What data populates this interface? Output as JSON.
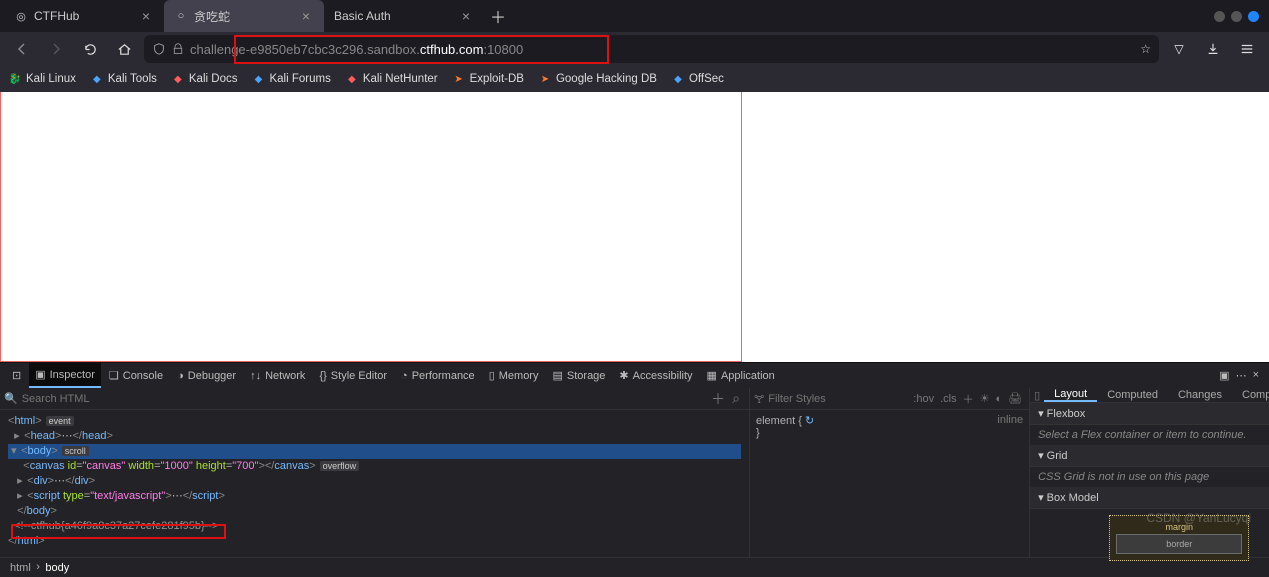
{
  "tabs": [
    {
      "label": "CTFHub",
      "active": false
    },
    {
      "label": "贪吃蛇",
      "active": true
    },
    {
      "label": "Basic Auth",
      "active": false
    }
  ],
  "url": {
    "prefix": "challenge-e9850eb7cbc3c296.sandbox.",
    "host": "ctfhub.com",
    "port": ":10800"
  },
  "bookmarks": [
    {
      "label": "Kali Linux",
      "icon": "🐉",
      "color": "#ccc"
    },
    {
      "label": "Kali Tools",
      "icon": "◆",
      "color": "#4aa3ff"
    },
    {
      "label": "Kali Docs",
      "icon": "◆",
      "color": "#ff5c5c"
    },
    {
      "label": "Kali Forums",
      "icon": "◆",
      "color": "#4aa3ff"
    },
    {
      "label": "Kali NetHunter",
      "icon": "◆",
      "color": "#ff5c5c"
    },
    {
      "label": "Exploit-DB",
      "icon": "➤",
      "color": "#ff7a2a"
    },
    {
      "label": "Google Hacking DB",
      "icon": "➤",
      "color": "#ff7a2a"
    },
    {
      "label": "OffSec",
      "icon": "◆",
      "color": "#4aa3ff"
    }
  ],
  "devtools": {
    "tabs": [
      "Inspector",
      "Console",
      "Debugger",
      "Network",
      "Style Editor",
      "Performance",
      "Memory",
      "Storage",
      "Accessibility",
      "Application"
    ],
    "active": "Inspector",
    "search_placeholder": "Search HTML",
    "html": {
      "line1_open": "<html>",
      "line1_badge": "event",
      "line2_head": "<head>",
      "line2_dots": "⋯",
      "line2_close": "</head>",
      "line3_body": "<body>",
      "line3_badge": "scroll",
      "line4_canvas": "<canvas id=\"canvas\" width=\"1000\" height=\"700\"></canvas>",
      "line4_badge": "overflow",
      "line5": "<div>⋯</div>",
      "line6": "<script type=\"text/javascript\">⋯</scr",
      "line6_end": "ipt>",
      "line7": "</body>",
      "line8_flag": "<!--ctfhub{a46f9a8c37a27cefe281f95b}-->",
      "line9": "</html>"
    },
    "styles": {
      "filter_placeholder": "Filter Styles",
      "btns": [
        ":hov",
        ".cls",
        "＋",
        "☀",
        "◐",
        "🖨"
      ],
      "rule_sel": "element {",
      "rule_close": "}",
      "inline": "inline"
    },
    "layout": {
      "tabs": [
        "Layout",
        "Computed",
        "Changes",
        "Compatibility"
      ],
      "flex_hd": "Flexbox",
      "flex_hint": "Select a Flex container or item to continue.",
      "grid_hd": "Grid",
      "grid_hint": "CSS Grid is not in use on this page",
      "bm_hd": "Box Model",
      "margin_label": "margin",
      "border_label": "border"
    },
    "crumb": [
      "html",
      "body"
    ]
  },
  "watermark": "CSDN @YanLucyqi",
  "win_colors": {
    "min": "#555",
    "max": "#555",
    "close": "#1d86ff"
  }
}
